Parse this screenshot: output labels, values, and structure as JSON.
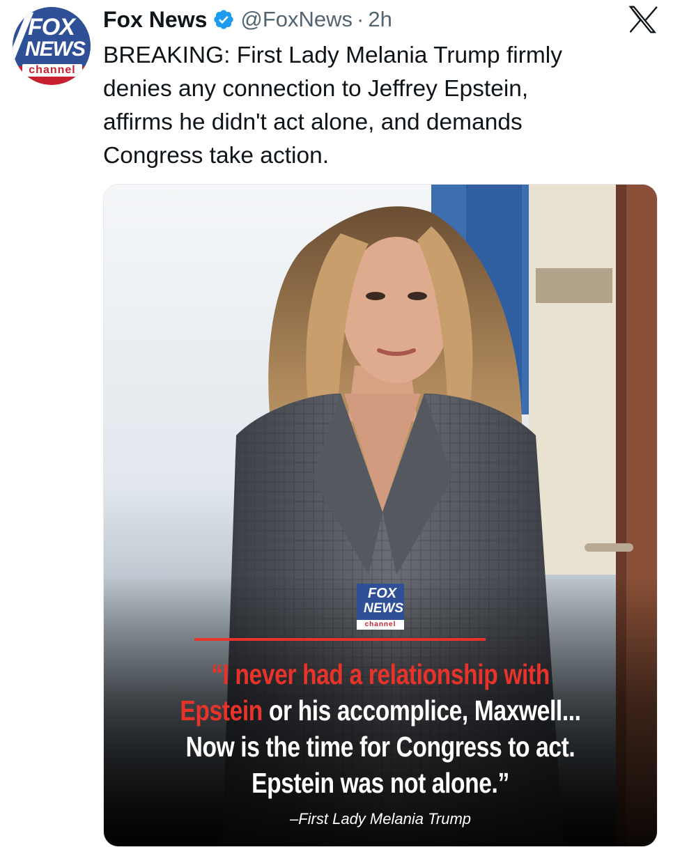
{
  "post": {
    "account_name": "Fox News",
    "handle": "@FoxNews",
    "separator": "·",
    "time": "2h",
    "avatar_text": {
      "fox": "FOX",
      "news": "NEWS",
      "channel": "channel"
    },
    "text_lines": [
      "BREAKING: First Lady Melania Trump firmly",
      "denies any connection to Jeffrey Epstein,",
      "affirms he didn't act alone, and demands",
      "Congress take action."
    ]
  },
  "media": {
    "badge": {
      "fox": "FOX",
      "news": "NEWS",
      "channel": "channel"
    },
    "quote": {
      "line1": "“I never had a relationship with",
      "line2_red": "Epstein",
      "line2_rest": " or his accomplice, Maxwell...",
      "line3": "Now is the time for Congress to act.",
      "line4": "Epstein was not alone.”"
    },
    "attribution": "–First Lady Melania Trump"
  },
  "icons": {
    "verified": "verified-badge-icon",
    "platform": "x-logo-icon"
  },
  "colors": {
    "text": "#0f1419",
    "secondary": "#536471",
    "verified": "#1d9bf0",
    "fox_blue": "#2f4f97",
    "fox_red": "#c8202f",
    "quote_red": "#e8332a"
  }
}
